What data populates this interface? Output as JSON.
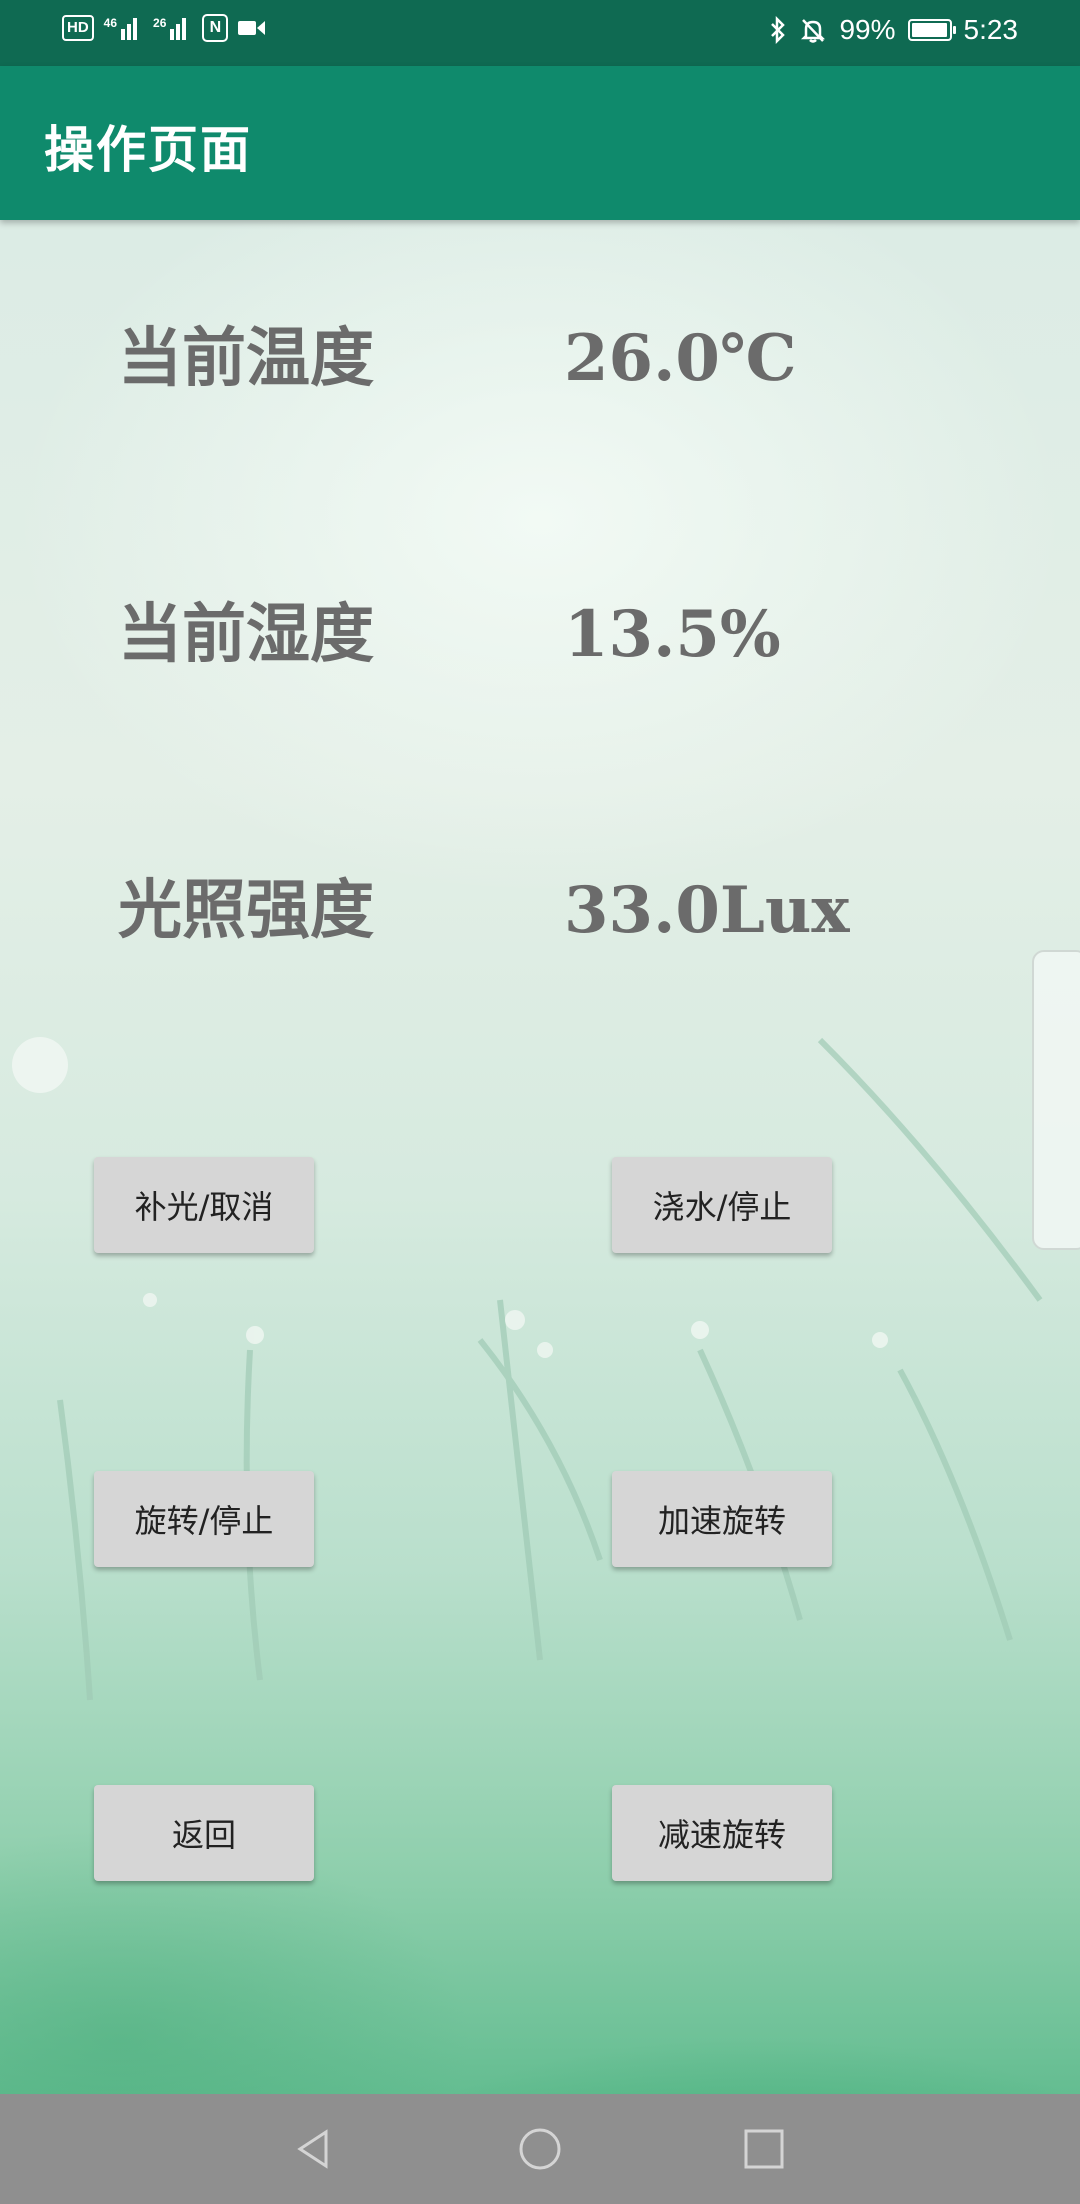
{
  "status_bar": {
    "left_tags": [
      "HD",
      "46",
      "26"
    ],
    "nfc_label": "N",
    "battery_text": "99%",
    "time": "5:23",
    "icons": [
      "hd-icon",
      "signal-4g-icon",
      "signal-2g-icon",
      "nfc-icon",
      "video-record-icon",
      "bluetooth-icon",
      "mute-bell-icon",
      "battery-icon"
    ]
  },
  "app_bar": {
    "title": "操作页面"
  },
  "readings": [
    {
      "label": "当前温度",
      "value": "26.0℃"
    },
    {
      "label": "当前湿度",
      "value": "13.5%"
    },
    {
      "label": "光照强度",
      "value": "33.0Lux"
    }
  ],
  "buttons": {
    "fill_light": "补光/取消",
    "water": "浇水/停止",
    "rotate": "旋转/停止",
    "speed_up": "加速旋转",
    "back": "返回",
    "slow_down": "减速旋转"
  },
  "colors": {
    "status_bar": "#0f6a52",
    "app_bar": "#0f8a6c",
    "reading_text": "#6b6b6b",
    "button_bg": "#d6d6d6",
    "nav_bar": "#8f8f8f"
  },
  "nav_bar": {
    "icons": [
      "back-triangle-icon",
      "home-circle-icon",
      "recent-square-icon"
    ]
  }
}
